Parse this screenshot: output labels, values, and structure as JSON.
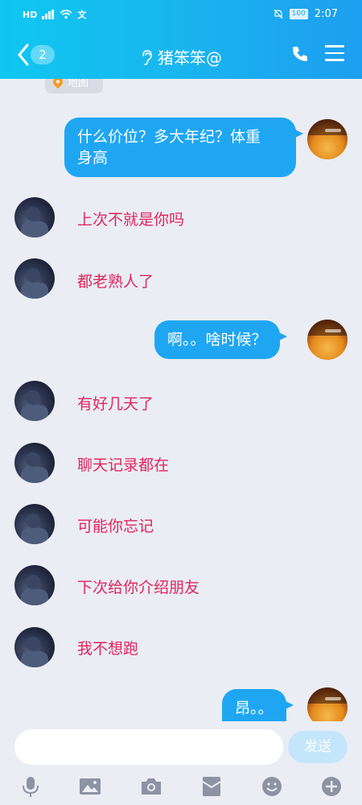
{
  "status": {
    "network": "HD",
    "battery": "100",
    "time": "2:07"
  },
  "header": {
    "unread_count": "2",
    "title": "猪笨笨@"
  },
  "chat": {
    "map_chip": "地图",
    "messages": [
      {
        "side": "right",
        "text_line1": "什么价位？多大年纪？体重",
        "text_line2": "身高"
      },
      {
        "side": "left",
        "text": "上次不就是你吗"
      },
      {
        "side": "left",
        "text": "都老熟人了"
      },
      {
        "side": "right",
        "text": "啊。。啥时候？"
      },
      {
        "side": "left",
        "text": "有好几天了"
      },
      {
        "side": "left",
        "text": "聊天记录都在"
      },
      {
        "side": "left",
        "text": "可能你忘记"
      },
      {
        "side": "left",
        "text": "下次给你介绍朋友"
      },
      {
        "side": "left",
        "text": "我不想跑"
      },
      {
        "side": "right",
        "text": "昂。。"
      }
    ]
  },
  "input": {
    "placeholder": "",
    "send_label": "发送"
  },
  "colors": {
    "header_start": "#10c7f1",
    "header_end": "#1d9ef0",
    "bubble_right": "#1fa6f3",
    "left_text": "#e3245c",
    "background": "#eaedf4"
  }
}
